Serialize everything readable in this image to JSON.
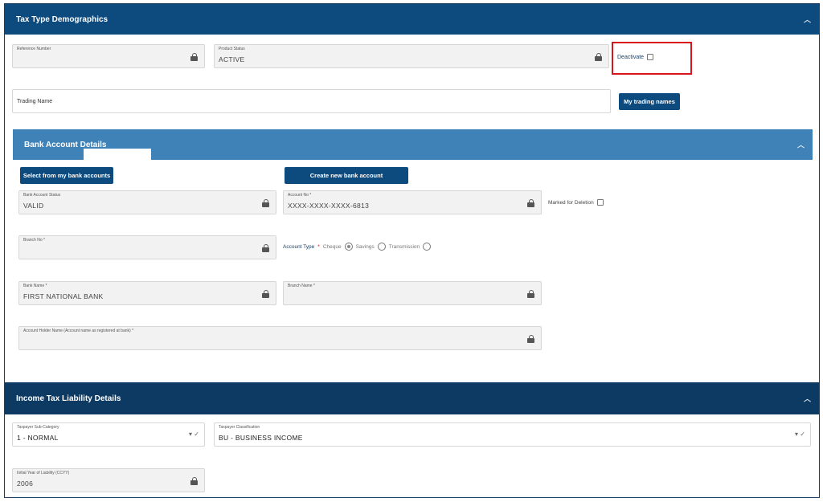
{
  "sections": {
    "tax_type": {
      "title": "Tax Type Demographics"
    },
    "bank_account": {
      "title": "Bank Account Details"
    },
    "income_tax": {
      "title": "Income Tax Liability Details"
    }
  },
  "tax_type": {
    "reference_number": {
      "label": "Reference Number",
      "value": ""
    },
    "product_status": {
      "label": "Product Status",
      "value": "ACTIVE"
    },
    "deactivate_label": "Deactivate",
    "trading_name": {
      "label": "Trading Name",
      "value": ""
    },
    "my_trading_names_button": "My trading names"
  },
  "bank_account": {
    "select_button": "Select from my bank accounts",
    "create_button": "Create new bank account",
    "bank_account_status": {
      "label": "Bank Account Status",
      "value": "VALID"
    },
    "account_no": {
      "label": "Account No *",
      "value": "XXXX-XXXX-XXXX-6813"
    },
    "marked_for_deletion_label": "Marked for Deletion",
    "branch_no": {
      "label": "Branch No *",
      "value": ""
    },
    "account_type": {
      "label": "Account Type",
      "required": "*",
      "options": [
        "Cheque",
        "Savings",
        "Transmission"
      ],
      "selected": "Cheque"
    },
    "bank_name": {
      "label": "Bank Name *",
      "value": "FIRST NATIONAL BANK"
    },
    "branch_name": {
      "label": "Branch Name *",
      "value": ""
    },
    "account_holder_name": {
      "label": "Account Holder Name (Account name as registered at bank) *",
      "value": ""
    }
  },
  "income_tax": {
    "taxpayer_sub_category": {
      "label": "Taxpayer Sub-Category",
      "value": "1 - NORMAL"
    },
    "taxpayer_classification": {
      "label": "Taxpayer Classification",
      "value": "BU - BUSINESS INCOME"
    },
    "initial_year_of_liability": {
      "label": "Initial Year of Liability (CCYY)",
      "value": "2006"
    }
  },
  "icons": {
    "lock": "lock-icon",
    "collapse": "chevron-up-icon",
    "dropdown": "dropdown-check-icon"
  },
  "colors": {
    "header_dark": "#0d4a7e",
    "header_light": "#3f82b8",
    "header_darkest": "#0c3a62",
    "highlight": "#d8141c"
  }
}
